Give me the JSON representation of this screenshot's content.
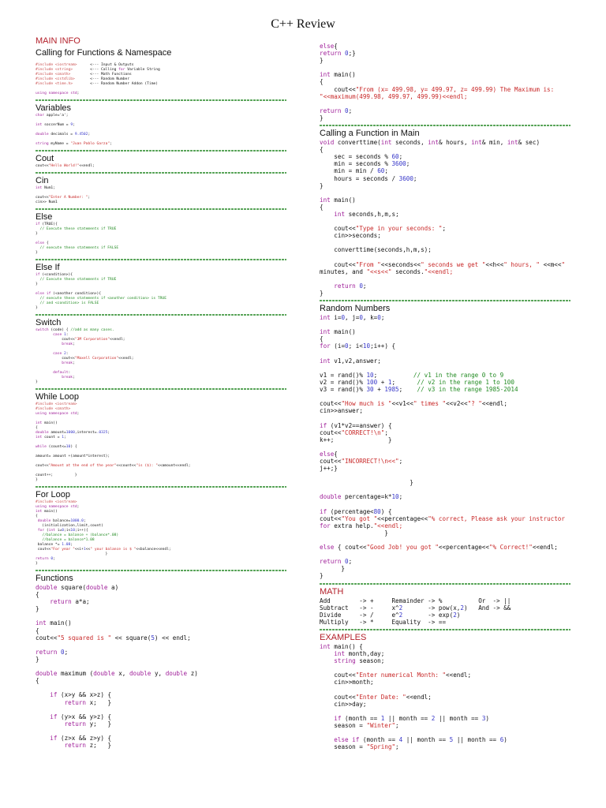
{
  "title": "C++ Review",
  "colors": {
    "heading_red": "#b3202a",
    "separator": "#5aa55a",
    "keyword": "#a0209a",
    "string": "#c82828",
    "number": "#3535c8",
    "comment": "#228b22"
  },
  "left": [
    {
      "heading": "MAIN INFO",
      "red": true,
      "subheading": "Calling for Functions & Namespace",
      "size": "tiny",
      "lines": [
        "#include <iostream>      <--- Input & Outputs",
        "#include <string>        <--- Calling for Variable String",
        "#include <cmath>         <--- Math Functions",
        "#include <cstdlib>       <--- Random Number",
        "#include <time.h>        <--- Random Number Addon (Time)",
        "",
        "using namespace std;"
      ]
    },
    {
      "heading": "Variables",
      "size": "tiny",
      "lines": [
        "char apple='a';",
        "",
        "int soccerNum = 9;",
        "",
        "double decimals = 9.4502;",
        "",
        "string myName = \"Juan Pablo Garza\";"
      ]
    },
    {
      "heading": "Cout",
      "size": "tiny",
      "lines": [
        "cout<<\"Hello World!\"<<endl;"
      ]
    },
    {
      "heading": "Cin",
      "size": "tiny",
      "lines": [
        "int Num1;",
        "",
        "cout<<\"Enter A Number: \";",
        "cin>> Num1"
      ]
    },
    {
      "heading": "Else",
      "size": "tiny",
      "lines": [
        "if (TRUE){",
        "  // Execute these statements if TRUE",
        "}",
        "",
        "else {",
        "  // execute these statements if FALSE",
        "}"
      ]
    },
    {
      "heading": "Else If",
      "size": "tiny",
      "lines": [
        "if (<condition>){",
        "  // Execute these statements if TRUE",
        "}",
        "",
        "else if (<another condition>){",
        "  // execute these statements if <another condition> is TRUE",
        "  // and <condition> is FALSE",
        "}"
      ]
    },
    {
      "heading": "Switch",
      "size": "tiny",
      "lines": [
        "switch (code) { //add as many cases.",
        "        case 1:",
        "            cout<<\"3M Corporation\"<<endl;",
        "            break;",
        "",
        "        case 2:",
        "            cout<<\"Maxell Corporation\"<<endl;",
        "            break;",
        "",
        "        default:",
        "            break;",
        "}"
      ]
    },
    {
      "heading": "While Loop",
      "size": "tiny",
      "lines": [
        "#include <iostream>",
        "#include <cmath>",
        "using namespace std;",
        "",
        "int main()",
        "{",
        "double amount=1000,interest=.0325;",
        "int count = 1;",
        "",
        "while (count<=10) {",
        "",
        "amount= amount +(amount*interest);",
        "",
        "cout<<\"Amount at the end of the year\"<<count<<\"is ($): \"<<amount<<endl;",
        "",
        "count++;          }",
        "}"
      ]
    },
    {
      "heading": "For Loop",
      "size": "tiny",
      "lines": [
        "#include <iostream>",
        "using namespace std;",
        "int main()",
        "{",
        " double balance=1000.0;",
        "   (initialization,limit,count)",
        " for (int i=0;i<10;i++){",
        "   //balance = balance + (balance*.08)",
        "   //balance = balance*1.08",
        " balance *= 1.08;",
        " cout<<\"For year \"<<i+1<<\" your balance is $ \"<<balance<<endl;",
        "                                }",
        "return 0;",
        "}"
      ]
    },
    {
      "heading": "Functions",
      "size": "med",
      "nosep": true,
      "lines": [
        "double square(double a)",
        "{",
        "    return a*a;",
        "}",
        "",
        "int main()",
        "{",
        "cout<<\"5 squared is \" << square(5) << endl;",
        "",
        "return 0;",
        "}",
        "",
        "double maximum (double x, double y, double z)",
        "{",
        "",
        "    if (x>y && x>z) {",
        "        return x;   }",
        "",
        "    if (y>x && y>z) {",
        "        return y;   }",
        "",
        "    if (z>x && z>y) {",
        "        return z;   }"
      ]
    }
  ],
  "right": [
    {
      "heading": "",
      "size": "med",
      "lines": [
        "else{",
        "return 0;}",
        "}",
        "",
        "int main()",
        "{",
        "    cout<<\"From (x= 499.98, y= 499.97, z= 499.99) The Maximum is:",
        "\"<<maximum(499.98, 499.97, 499.99)<<endl;",
        "",
        "return 0;",
        "}"
      ]
    },
    {
      "heading": "Calling a Function in Main",
      "size": "med",
      "lines": [
        "void converttime(int seconds, int& hours, int& min, int& sec)",
        "{",
        "    sec = seconds % 60;",
        "    min = seconds % 3600;",
        "    min = min / 60;",
        "    hours = seconds / 3600;",
        "}",
        "",
        "int main()",
        "{",
        "    int seconds,h,m,s;",
        "",
        "    cout<<\"Type in your seconds: \";",
        "    cin>>seconds;",
        "",
        "    converttime(seconds,h,m,s);",
        "",
        "    cout<<\"From \"<<seconds<<\" seconds we get \"<<h<<\" hours, \" <<m<<\"",
        "minutes, and \"<<s<<\" seconds.\"<<endl;",
        "",
        "    return 0;",
        "}"
      ]
    },
    {
      "heading": "Random Numbers",
      "size": "med",
      "lines": [
        "int i=0, j=0, k=0;",
        "",
        "int main()",
        "{",
        "for (i=0; i<10;i++) {",
        "",
        "int v1,v2,answer;",
        "",
        "v1 = rand()% 10;          // v1 in the range 0 to 9",
        "v2 = rand()% 100 + 1;      // v2 in the range 1 to 100",
        "v3 = rand()% 30 + 1985;    // v3 in the range 1985-2014",
        "",
        "cout<<\"How much is \"<<v1<<\" times \"<<v2<<\"? \"<<endl;",
        "cin>>answer;",
        "",
        "if (v1*v2==answer) {",
        "cout<<\"CORRECT!\\n\";",
        "k++;               }",
        "",
        "else{",
        "cout<<\"INCORRECT!\\n<<\";",
        "j++;}",
        "",
        "                         }",
        "",
        "double percentage=k*10;",
        "",
        "if (percentage<80) {",
        "cout<<\"You got \"<<percentage<<\"% correct, Please ask your instructor",
        "for extra help.\"<<endl;",
        "                  }",
        "",
        "else { cout<<\"Good Job! you got \"<<percentage<<\"% Correct!\"<<endl;",
        "",
        "return 0;",
        "      }",
        "}"
      ]
    },
    {
      "heading": "MATH",
      "red": true,
      "size": "med",
      "lines": [
        "Add        -> +     Remainder -> %          Or  -> ||",
        "Subtract   -> -     x^2       -> pow(x,2)   And -> &&",
        "Divide     -> /     e^2       -> exp(2)",
        "Multiply   -> *     Equality  -> =="
      ]
    },
    {
      "heading": "EXAMPLES",
      "red": true,
      "size": "med",
      "nosep": true,
      "lines": [
        "int main() {",
        "    int month,day;",
        "    string season;",
        "",
        "    cout<<\"Enter numerical Month: \"<<endl;",
        "    cin>>month;",
        "",
        "    cout<<\"Enter Date: \"<<endl;",
        "    cin>>day;",
        "",
        "    if (month == 1 || month == 2 || month == 3)",
        "    season = \"Winter\";",
        "",
        "    else if (month == 4 || month == 5 || month == 6)",
        "    season = \"Spring\";"
      ]
    }
  ]
}
